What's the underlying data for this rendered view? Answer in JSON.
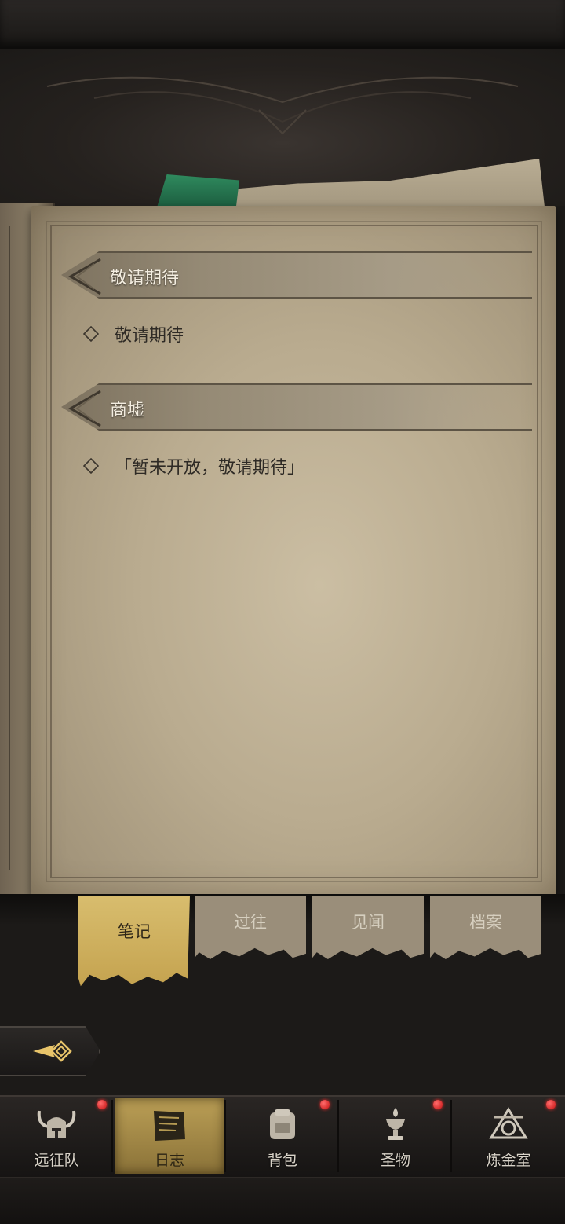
{
  "journal": {
    "sections": [
      {
        "title": "敬请期待",
        "entries": [
          "敬请期待"
        ]
      },
      {
        "title": "商墟",
        "entries": [
          "「暂未开放，敬请期待」"
        ]
      }
    ]
  },
  "tabs": [
    {
      "label": "笔记",
      "active": true
    },
    {
      "label": "过往",
      "active": false
    },
    {
      "label": "见闻",
      "active": false
    },
    {
      "label": "档案",
      "active": false
    }
  ],
  "bottom_nav": [
    {
      "label": "远征队",
      "icon": "horned-helmet-icon",
      "badge": true,
      "active": false
    },
    {
      "label": "日志",
      "icon": "journal-book-icon",
      "badge": false,
      "active": true
    },
    {
      "label": "背包",
      "icon": "backpack-icon",
      "badge": true,
      "active": false
    },
    {
      "label": "圣物",
      "icon": "chalice-icon",
      "badge": true,
      "active": false
    },
    {
      "label": "炼金室",
      "icon": "alchemy-icon",
      "badge": true,
      "active": false
    }
  ],
  "colors": {
    "badge": "#d41a1a",
    "active_tab": "#d1b564",
    "parchment": "#b9ab8f"
  }
}
